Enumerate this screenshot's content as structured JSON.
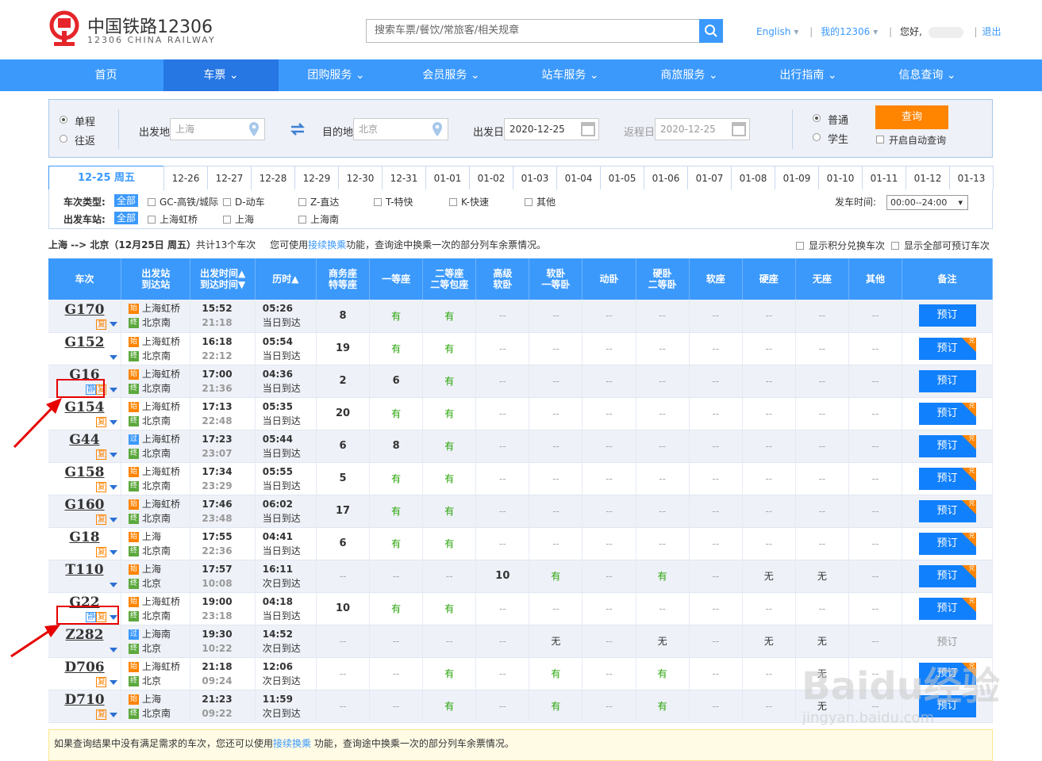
{
  "header": {
    "logo_cn": "中国铁路12306",
    "logo_en": "12306 CHINA RAILWAY",
    "search_placeholder": "搜索车票/餐饮/常旅客/相关规章",
    "link_english": "English",
    "link_my": "我的12306",
    "greeting": "您好,",
    "logout": "退出"
  },
  "nav": [
    "首页",
    "车票",
    "团购服务",
    "会员服务",
    "站车服务",
    "商旅服务",
    "出行指南",
    "信息查询"
  ],
  "query": {
    "trip_oneway": "单程",
    "trip_round": "往返",
    "from_label": "出发地",
    "from_value": "上海",
    "to_label": "目的地",
    "to_value": "北京",
    "depart_label": "出发日",
    "depart_value": "2020-12-25",
    "return_label": "返程日",
    "return_value": "2020-12-25",
    "type_normal": "普通",
    "type_student": "学生",
    "query_button": "查询",
    "auto_query": "开启自动查询"
  },
  "dates": [
    "12-25 周五",
    "12-26",
    "12-27",
    "12-28",
    "12-29",
    "12-30",
    "12-31",
    "01-01",
    "01-02",
    "01-03",
    "01-04",
    "01-05",
    "01-06",
    "01-07",
    "01-08",
    "01-09",
    "01-10",
    "01-11",
    "01-12",
    "01-13"
  ],
  "filter": {
    "type_label": "车次类型:",
    "station_label": "出发车站:",
    "all": "全部",
    "types": [
      "GC-高铁/城际",
      "D-动车",
      "Z-直达",
      "T-特快",
      "K-快速",
      "其他"
    ],
    "stations": [
      "上海虹桥",
      "上海",
      "上海南"
    ],
    "time_label": "发车时间:",
    "time_value": "00:00--24:00"
  },
  "summary": {
    "route": "上海 --> 北京（12月25日  周五）",
    "count": "共计13个车次",
    "tip_pre": "您可使用",
    "tip_link": "接续换乘",
    "tip_post": "功能，查询途中换乘一次的部分列车余票情况。",
    "opt_points": "显示积分兑换车次",
    "opt_all": "显示全部可预订车次"
  },
  "columns": [
    "车次",
    "出发站\n到达站",
    "出发时间▲\n到达时间▼",
    "历时▲",
    "商务座\n特等座",
    "一等座",
    "二等座\n二等包座",
    "高级\n软卧",
    "软卧\n一等卧",
    "动卧",
    "硬卧\n二等卧",
    "软座",
    "硬座",
    "无座",
    "其他",
    "备注"
  ],
  "trains": [
    {
      "no": "G170",
      "jing": false,
      "fu": true,
      "from": "上海虹桥",
      "fromType": "始",
      "to": "北京南",
      "dep": "15:52",
      "arr": "21:18",
      "dur": "05:26",
      "day": "当日到达",
      "seats": [
        "8",
        "有",
        "有",
        "--",
        "--",
        "--",
        "--",
        "--",
        "--",
        "--",
        "--"
      ],
      "book": "预订",
      "dui": false,
      "bookable": true
    },
    {
      "no": "G152",
      "jing": false,
      "fu": false,
      "from": "上海虹桥",
      "fromType": "始",
      "to": "北京南",
      "dep": "16:18",
      "arr": "22:12",
      "dur": "05:54",
      "day": "当日到达",
      "seats": [
        "19",
        "有",
        "有",
        "--",
        "--",
        "--",
        "--",
        "--",
        "--",
        "--",
        "--"
      ],
      "book": "预订",
      "dui": true,
      "bookable": true
    },
    {
      "no": "G16",
      "jing": true,
      "fu": true,
      "from": "上海虹桥",
      "fromType": "始",
      "to": "北京南",
      "dep": "17:00",
      "arr": "21:36",
      "dur": "04:36",
      "day": "当日到达",
      "seats": [
        "2",
        "6",
        "有",
        "--",
        "--",
        "--",
        "--",
        "--",
        "--",
        "--",
        "--"
      ],
      "book": "预订",
      "dui": false,
      "bookable": true
    },
    {
      "no": "G154",
      "jing": false,
      "fu": true,
      "from": "上海虹桥",
      "fromType": "始",
      "to": "北京南",
      "dep": "17:13",
      "arr": "22:48",
      "dur": "05:35",
      "day": "当日到达",
      "seats": [
        "20",
        "有",
        "有",
        "--",
        "--",
        "--",
        "--",
        "--",
        "--",
        "--",
        "--"
      ],
      "book": "预订",
      "dui": true,
      "bookable": true
    },
    {
      "no": "G44",
      "jing": false,
      "fu": true,
      "from": "上海虹桥",
      "fromType": "过",
      "to": "北京南",
      "dep": "17:23",
      "arr": "23:07",
      "dur": "05:44",
      "day": "当日到达",
      "seats": [
        "6",
        "8",
        "有",
        "--",
        "--",
        "--",
        "--",
        "--",
        "--",
        "--",
        "--"
      ],
      "book": "预订",
      "dui": true,
      "bookable": true
    },
    {
      "no": "G158",
      "jing": false,
      "fu": true,
      "from": "上海虹桥",
      "fromType": "始",
      "to": "北京南",
      "dep": "17:34",
      "arr": "23:29",
      "dur": "05:55",
      "day": "当日到达",
      "seats": [
        "5",
        "有",
        "有",
        "--",
        "--",
        "--",
        "--",
        "--",
        "--",
        "--",
        "--"
      ],
      "book": "预订",
      "dui": true,
      "bookable": true
    },
    {
      "no": "G160",
      "jing": false,
      "fu": true,
      "from": "上海虹桥",
      "fromType": "始",
      "to": "北京南",
      "dep": "17:46",
      "arr": "23:48",
      "dur": "06:02",
      "day": "当日到达",
      "seats": [
        "17",
        "有",
        "有",
        "--",
        "--",
        "--",
        "--",
        "--",
        "--",
        "--",
        "--"
      ],
      "book": "预订",
      "dui": true,
      "bookable": true
    },
    {
      "no": "G18",
      "jing": false,
      "fu": true,
      "from": "上海",
      "fromType": "始",
      "to": "北京南",
      "dep": "17:55",
      "arr": "22:36",
      "dur": "04:41",
      "day": "当日到达",
      "seats": [
        "6",
        "有",
        "有",
        "--",
        "--",
        "--",
        "--",
        "--",
        "--",
        "--",
        "--"
      ],
      "book": "预订",
      "dui": true,
      "bookable": true
    },
    {
      "no": "T110",
      "jing": false,
      "fu": false,
      "from": "上海",
      "fromType": "始",
      "to": "北京",
      "dep": "17:57",
      "arr": "10:08",
      "dur": "16:11",
      "day": "次日到达",
      "seats": [
        "--",
        "--",
        "--",
        "10",
        "有",
        "--",
        "有",
        "--",
        "无",
        "无",
        "--"
      ],
      "book": "预订",
      "dui": true,
      "bookable": true
    },
    {
      "no": "G22",
      "jing": true,
      "fu": true,
      "from": "上海虹桥",
      "fromType": "始",
      "to": "北京南",
      "dep": "19:00",
      "arr": "23:18",
      "dur": "04:18",
      "day": "当日到达",
      "seats": [
        "10",
        "有",
        "有",
        "--",
        "--",
        "--",
        "--",
        "--",
        "--",
        "--",
        "--"
      ],
      "book": "预订",
      "dui": true,
      "bookable": true
    },
    {
      "no": "Z282",
      "jing": false,
      "fu": false,
      "from": "上海南",
      "fromType": "过",
      "to": "北京",
      "dep": "19:30",
      "arr": "10:22",
      "dur": "14:52",
      "day": "次日到达",
      "seats": [
        "--",
        "--",
        "--",
        "--",
        "无",
        "--",
        "无",
        "--",
        "无",
        "无",
        "--"
      ],
      "book": "预订",
      "dui": false,
      "bookable": false
    },
    {
      "no": "D706",
      "jing": false,
      "fu": true,
      "from": "上海虹桥",
      "fromType": "始",
      "to": "北京",
      "dep": "21:18",
      "arr": "09:24",
      "dur": "12:06",
      "day": "次日到达",
      "seats": [
        "--",
        "--",
        "有",
        "--",
        "有",
        "--",
        "有",
        "--",
        "--",
        "无",
        "--"
      ],
      "book": "预订",
      "dui": true,
      "bookable": true
    },
    {
      "no": "D710",
      "jing": false,
      "fu": true,
      "from": "上海",
      "fromType": "始",
      "to": "北京南",
      "dep": "21:23",
      "arr": "09:22",
      "dur": "11:59",
      "day": "次日到达",
      "seats": [
        "--",
        "--",
        "有",
        "--",
        "有",
        "--",
        "有",
        "--",
        "--",
        "无",
        "--"
      ],
      "book": "预订",
      "dui": false,
      "bookable": true
    }
  ],
  "labels": {
    "fu": "复",
    "jing": "静",
    "end": "终",
    "dui": "兑"
  },
  "notice": {
    "pre": "如果查询结果中没有满足需求的车次，您还可以使用",
    "link": "接续换乘",
    "post": " 功能，查询途中换乘一次的部分列车余票情况。"
  },
  "watermark": {
    "main": "Baidu经验",
    "sub": "jingyan.baidu.com"
  }
}
